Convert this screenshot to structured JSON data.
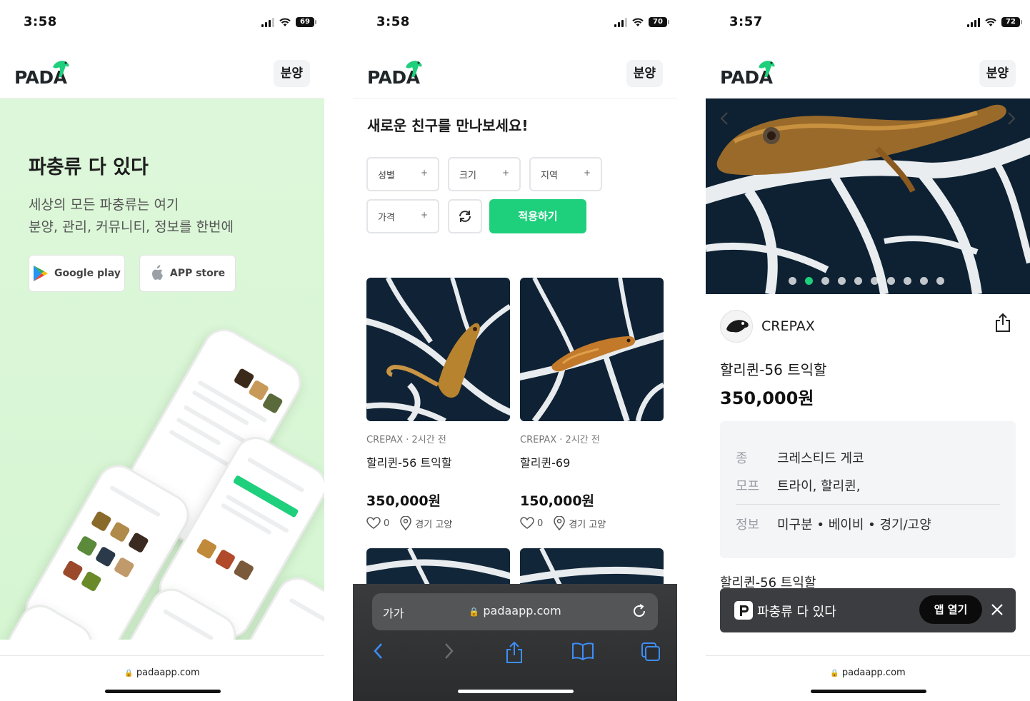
{
  "screens": [
    {
      "time": "3:58",
      "battery": "69",
      "logo": "PADA",
      "header_button": "분양",
      "hero": {
        "title": "파충류 다 있다",
        "subtitle_line1": "세상의 모든 파충류는 여기",
        "subtitle_line2": "분양, 관리, 커뮤니티, 정보를 한번에",
        "google_play": "Google play",
        "app_store": "APP store"
      },
      "url": "padaapp.com"
    },
    {
      "time": "3:58",
      "battery": "70",
      "logo": "PADA",
      "header_button": "분양",
      "title": "새로운 친구를 만나보세요!",
      "filters": [
        "성별",
        "크기",
        "지역",
        "가격"
      ],
      "apply_button": "적용하기",
      "listings": [
        {
          "meta": "CREPAX · 2시간 전",
          "name": "할리퀸-56 트익할",
          "price": "350,000원",
          "likes": "0",
          "location": "경기 고양"
        },
        {
          "meta": "CREPAX · 2시간 전",
          "name": "할리퀸-69",
          "price": "150,000원",
          "likes": "0",
          "location": "경기 고양"
        }
      ],
      "safari": {
        "text_size": "가가",
        "url": "padaapp.com"
      }
    },
    {
      "time": "3:57",
      "battery": "72",
      "logo": "PADA",
      "header_button": "분양",
      "gallery": {
        "total": 10,
        "active": 2
      },
      "seller": "CREPAX",
      "product_title": "할리퀸-56 트익할",
      "product_price": "350,000원",
      "info": [
        {
          "key": "종",
          "value": "크레스티드 게코"
        },
        {
          "key": "모프",
          "value": "트라이, 할리퀸,"
        },
        {
          "key": "정보",
          "value": "미구분 • 베이비 • 경기/고양"
        }
      ],
      "description_title": "할리퀸-56 트익할",
      "banner": {
        "text": "파충류 다 있다",
        "open_button": "앱 열기"
      },
      "url": "padaapp.com"
    }
  ],
  "colors": {
    "accent": "#1ecf7c",
    "hero_bg": "#d9f7d5",
    "logo_dark": "#1f2529"
  }
}
